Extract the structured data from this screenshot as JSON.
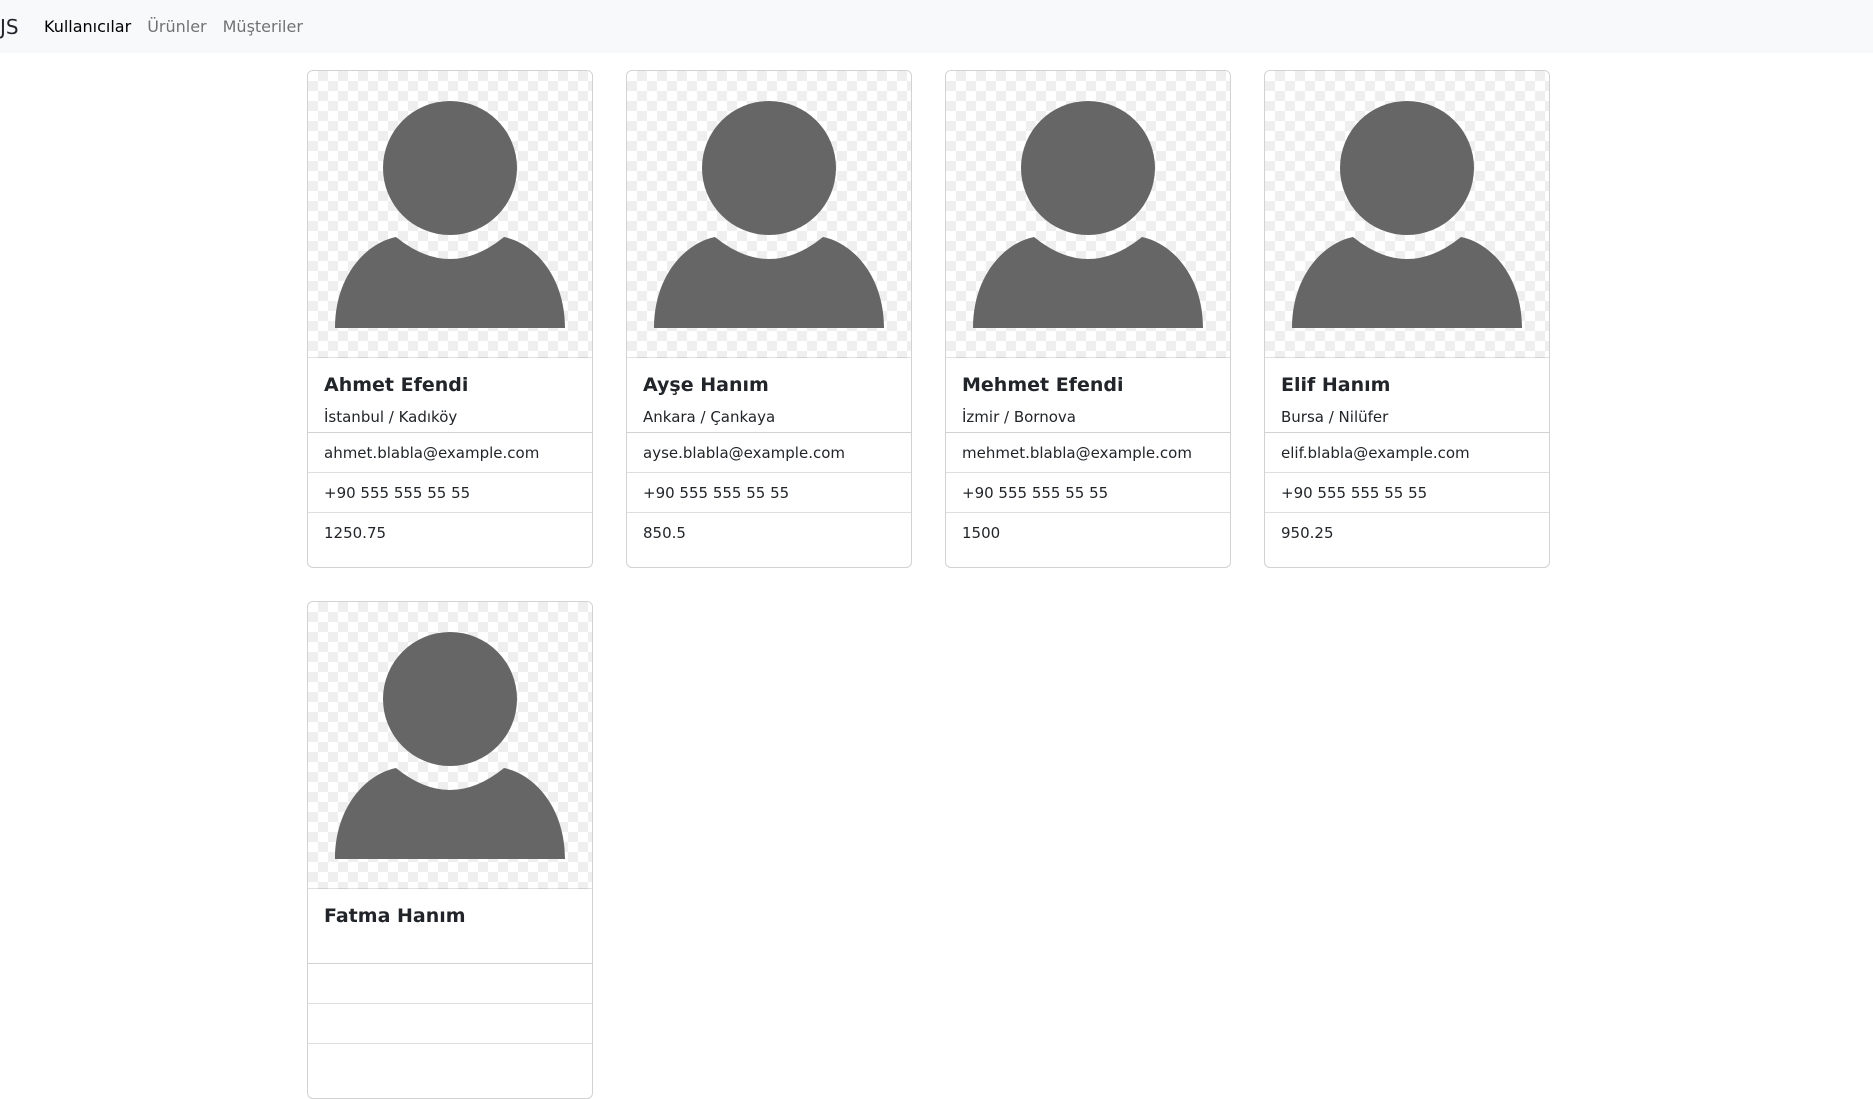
{
  "navbar": {
    "brand": "JS",
    "links": [
      {
        "label": "Kullanıcılar"
      },
      {
        "label": "Ürünler"
      },
      {
        "label": "Müşteriler"
      }
    ]
  },
  "users": [
    {
      "name": "Ahmet Efendi",
      "location": "İstanbul / Kadıköy",
      "email": "ahmet.blabla@example.com",
      "phone": "+90 555 555 55 55",
      "balance": "1250.75"
    },
    {
      "name": "Ayşe Hanım",
      "location": "Ankara / Çankaya",
      "email": "ayse.blabla@example.com",
      "phone": "+90 555 555 55 55",
      "balance": "850.5"
    },
    {
      "name": "Mehmet Efendi",
      "location": "İzmir / Bornova",
      "email": "mehmet.blabla@example.com",
      "phone": "+90 555 555 55 55",
      "balance": "1500"
    },
    {
      "name": "Elif Hanım",
      "location": "Bursa / Nilüfer",
      "email": "elif.blabla@example.com",
      "phone": "+90 555 555 55 55",
      "balance": "950.25"
    },
    {
      "name": "Fatma Hanım",
      "location": "",
      "email": "",
      "phone": "",
      "balance": ""
    }
  ],
  "colors": {
    "avatar": "#666666",
    "navbar_bg": "#f8f9fa"
  },
  "icons": {
    "avatar": "user-avatar-icon"
  }
}
